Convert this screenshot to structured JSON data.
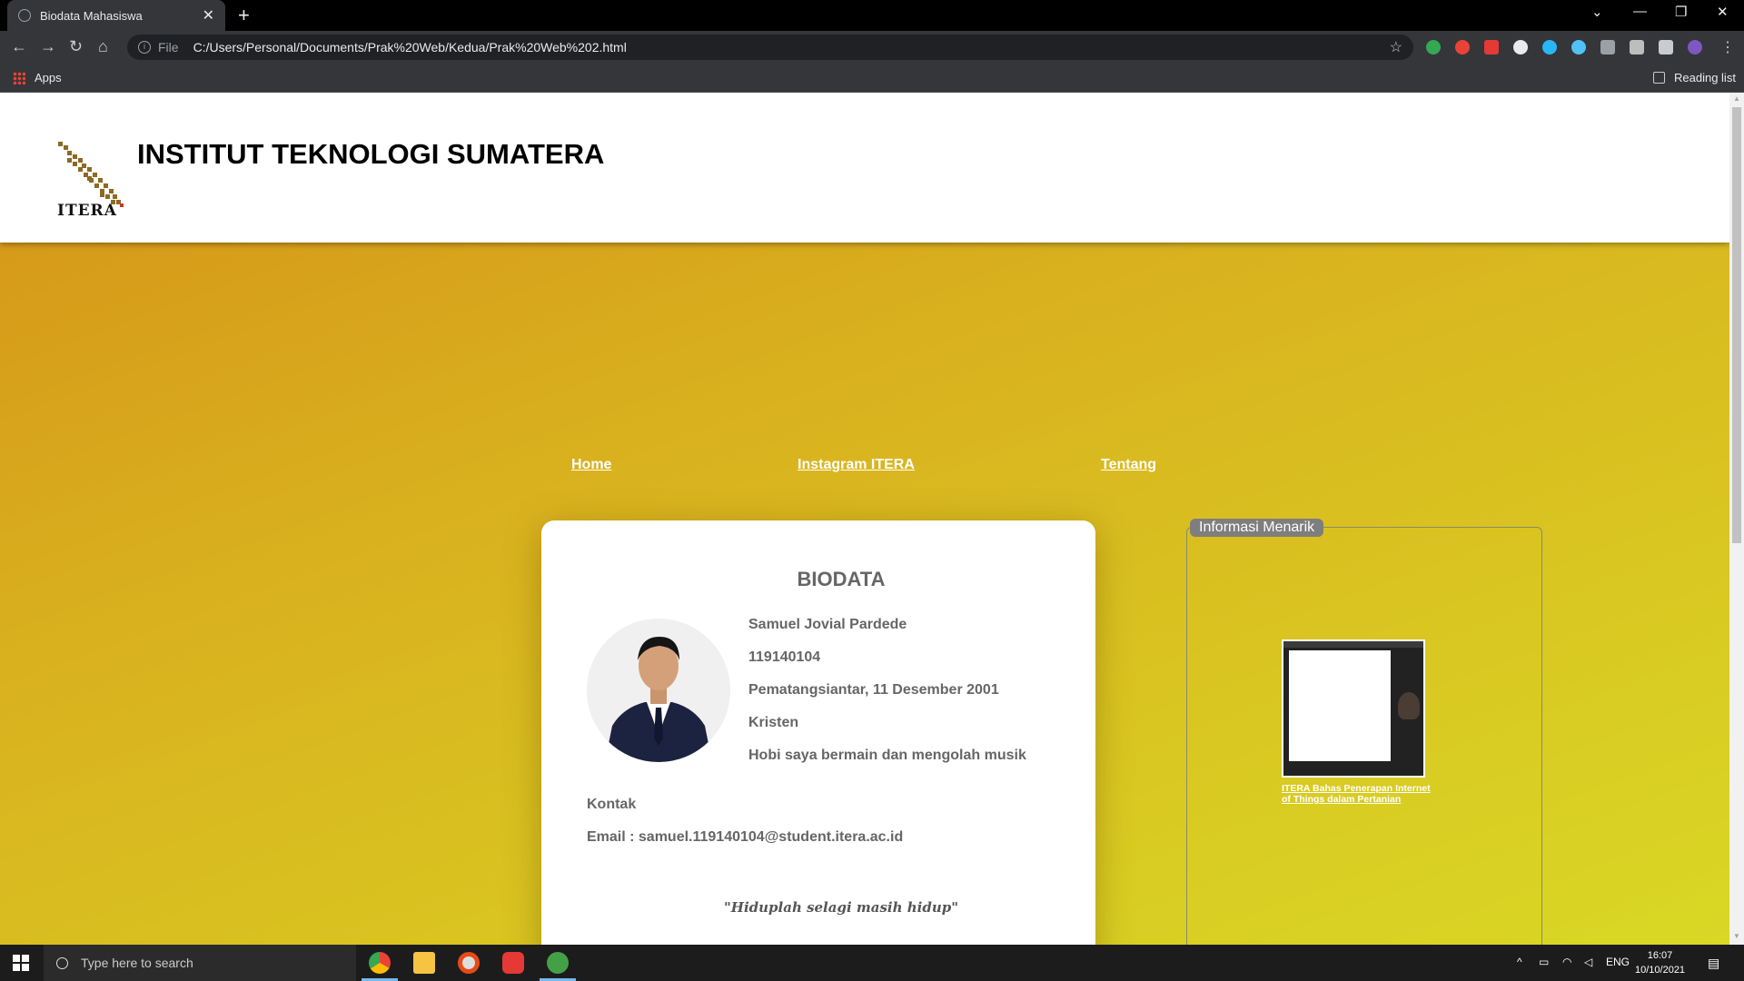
{
  "browser": {
    "tab_title": "Biodata Mahasiswa",
    "tab_close": "✕",
    "new_tab": "+",
    "file_label": "File",
    "url": "C:/Users/Personal/Documents/Prak%20Web/Kedua/Prak%20Web%202.html",
    "bookmarks_apps": "Apps",
    "reading_list": "Reading list"
  },
  "site": {
    "logo_text": "ITERA",
    "title": "INSTITUT TEKNOLOGI SUMATERA",
    "menu": [
      "Home",
      "Instagram ITERA",
      "Tentang"
    ]
  },
  "biodata": {
    "heading": "BIODATA",
    "name": "Samuel Jovial Pardede",
    "nim": "119140104",
    "birth": "Pematangsiantar, 11 Desember 2001",
    "religion": "Kristen",
    "hobby": "Hobi saya bermain dan mengolah musik",
    "contact_label": "Kontak",
    "email": "Email : samuel.119140104@student.itera.ac.id",
    "quote": "\"Hiduplah selagi masih hidup\""
  },
  "sidebar": {
    "legend": "Informasi Menarik",
    "article_link": "ITERA Bahas Penerapan Internet of Things dalam Pertanian"
  },
  "taskbar": {
    "search_placeholder": "Type here to search",
    "language": "ENG",
    "time": "16:07",
    "date": "10/10/2021"
  },
  "colors": {
    "hero_start": "#d69a19",
    "hero_end": "#d9d925",
    "accent_blue": "#76b9ed"
  }
}
